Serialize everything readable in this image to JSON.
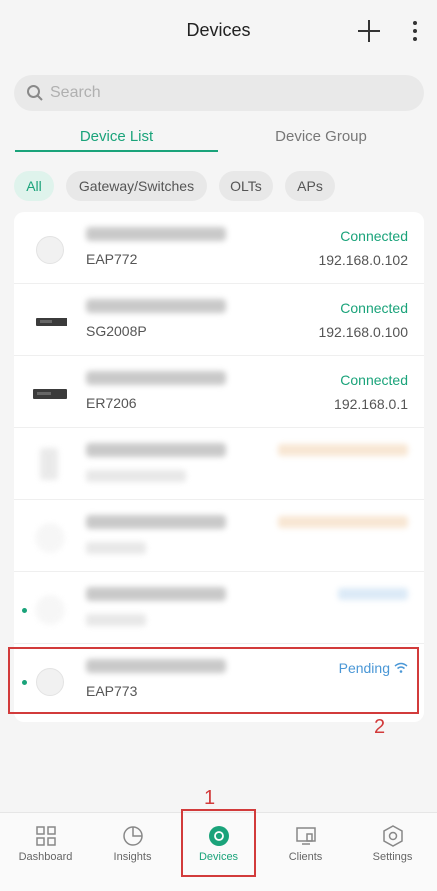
{
  "header": {
    "title": "Devices"
  },
  "search": {
    "placeholder": "Search"
  },
  "tabs": {
    "device_list": "Device List",
    "device_group": "Device Group"
  },
  "filters": [
    "All",
    "Gateway/Switches",
    "OLTs",
    "APs"
  ],
  "devices": [
    {
      "model": "EAP772",
      "status": "Connected",
      "ip": "192.168.0.102"
    },
    {
      "model": "SG2008P",
      "status": "Connected",
      "ip": "192.168.0.100"
    },
    {
      "model": "ER7206",
      "status": "Connected",
      "ip": "192.168.0.1"
    },
    {
      "model": "",
      "status": "",
      "ip": ""
    },
    {
      "model": "",
      "status": "",
      "ip": ""
    },
    {
      "model": "",
      "status": "",
      "ip": ""
    },
    {
      "model": "EAP773",
      "status": "Pending",
      "ip": ""
    }
  ],
  "annotations": {
    "nav_marker": "1",
    "row_marker": "2"
  },
  "nav": [
    "Dashboard",
    "Insights",
    "Devices",
    "Clients",
    "Settings"
  ],
  "colors": {
    "accent": "#1aa37a",
    "pending": "#4a97d6",
    "managed": "#e7a766",
    "annotation": "#d23b3b"
  }
}
